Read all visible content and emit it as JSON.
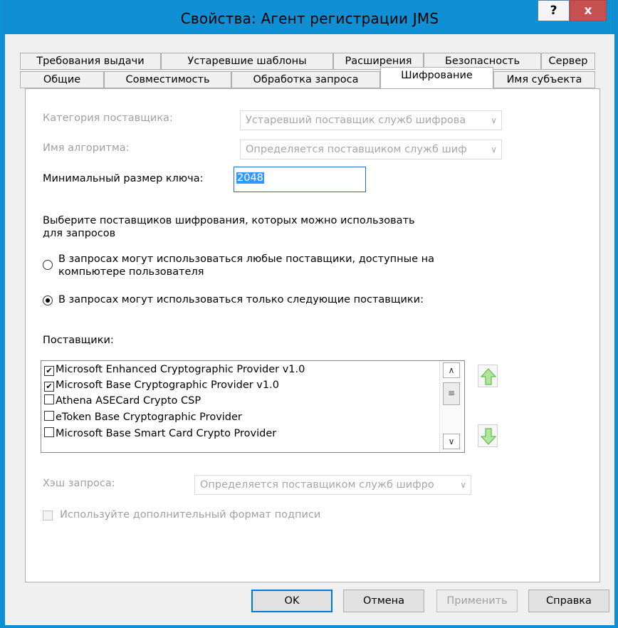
{
  "window": {
    "title": "Свойства: Агент регистрации JMS",
    "help_label": "?",
    "close_label": "x"
  },
  "tabs": {
    "row1": [
      "Требования выдачи",
      "Устаревшие шаблоны",
      "Расширения",
      "Безопасность",
      "Сервер"
    ],
    "row2": [
      "Общие",
      "Совместимость",
      "Обработка запроса",
      "Шифрование",
      "Имя субъекта"
    ],
    "active": "Шифрование"
  },
  "form": {
    "provider_category_label": "Категория поставщика:",
    "provider_category_value": "Устаревший поставщик служб шифрова",
    "algorithm_label": "Имя алгоритма:",
    "algorithm_value": "Определяется поставщиком служб шиф",
    "min_key_label": "Минимальный размер ключа:",
    "min_key_value": "2048",
    "choose_text_1": "Выберите поставщиков шифрования, которых можно использовать",
    "choose_text_2": "для запросов",
    "radio_any_1": "В запросах могут использоваться любые поставщики, доступные на",
    "radio_any_2": "компьютере пользователя",
    "radio_only": "В запросах могут использоваться только следующие поставщики:",
    "providers_label": "Поставщики:",
    "providers": [
      {
        "name": "Microsoft Enhanced Cryptographic Provider v1.0",
        "checked": true
      },
      {
        "name": "Microsoft Base Cryptographic Provider v1.0",
        "checked": true
      },
      {
        "name": "Athena ASECard Crypto CSP",
        "checked": false
      },
      {
        "name": "eToken Base Cryptographic Provider",
        "checked": false
      },
      {
        "name": "Microsoft Base Smart Card Crypto Provider",
        "checked": false
      }
    ],
    "hash_label": "Хэш запроса:",
    "hash_value": "Определяется поставщиком служб шифро",
    "alt_sig_label": "Используйте дополнительный формат подписи"
  },
  "buttons": {
    "ok": "OK",
    "cancel": "Отмена",
    "apply": "Применить",
    "help": "Справка"
  },
  "colors": {
    "titlebar": "#0f8fd4",
    "close": "#c75050",
    "arrow_green": "#5bbf4a"
  }
}
